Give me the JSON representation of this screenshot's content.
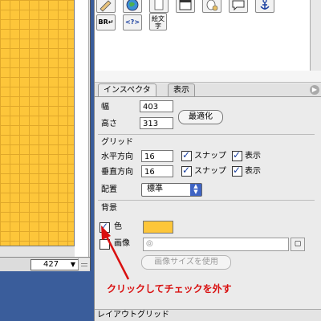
{
  "document": {
    "zoom_value": "427"
  },
  "palette": {
    "tools": [
      {
        "icon": "pencil-tool-icon",
        "label": ""
      },
      {
        "icon": "globe-icon",
        "label": ""
      },
      {
        "icon": "blank-page-icon",
        "label": ""
      },
      {
        "icon": "window-icon",
        "label": ""
      },
      {
        "icon": "mouse-icon",
        "label": ""
      },
      {
        "icon": "speech-bubble-icon",
        "label": ""
      },
      {
        "icon": "anchor-icon",
        "label": ""
      },
      {
        "icon": "line-break-icon",
        "label": "BR"
      },
      {
        "icon": "code-icon",
        "label": "<?>"
      },
      {
        "icon": "text-image-icon",
        "label": "絵文字"
      }
    ]
  },
  "inspector": {
    "tabs": [
      "インスペクタ",
      "表示"
    ],
    "width_label": "幅",
    "width_value": "403",
    "height_label": "高さ",
    "height_value": "313",
    "optimize_button": "最適化",
    "grid_section": "グリッド",
    "horizontal_label": "水平方向",
    "horizontal_value": "16",
    "vertical_label": "垂直方向",
    "vertical_value": "16",
    "snap_label": "スナップ",
    "show_label": "表示",
    "placement_label": "配置",
    "placement_value": "標準",
    "background_section": "背景",
    "color_label": "色",
    "color_value": "#fdc63a",
    "image_label": "画像",
    "use_image_size_button": "画像サイズを使用",
    "status_text": "レイアウトグリッド"
  },
  "annotation": {
    "text": "クリックしてチェックを外す",
    "color": "#d91010"
  }
}
